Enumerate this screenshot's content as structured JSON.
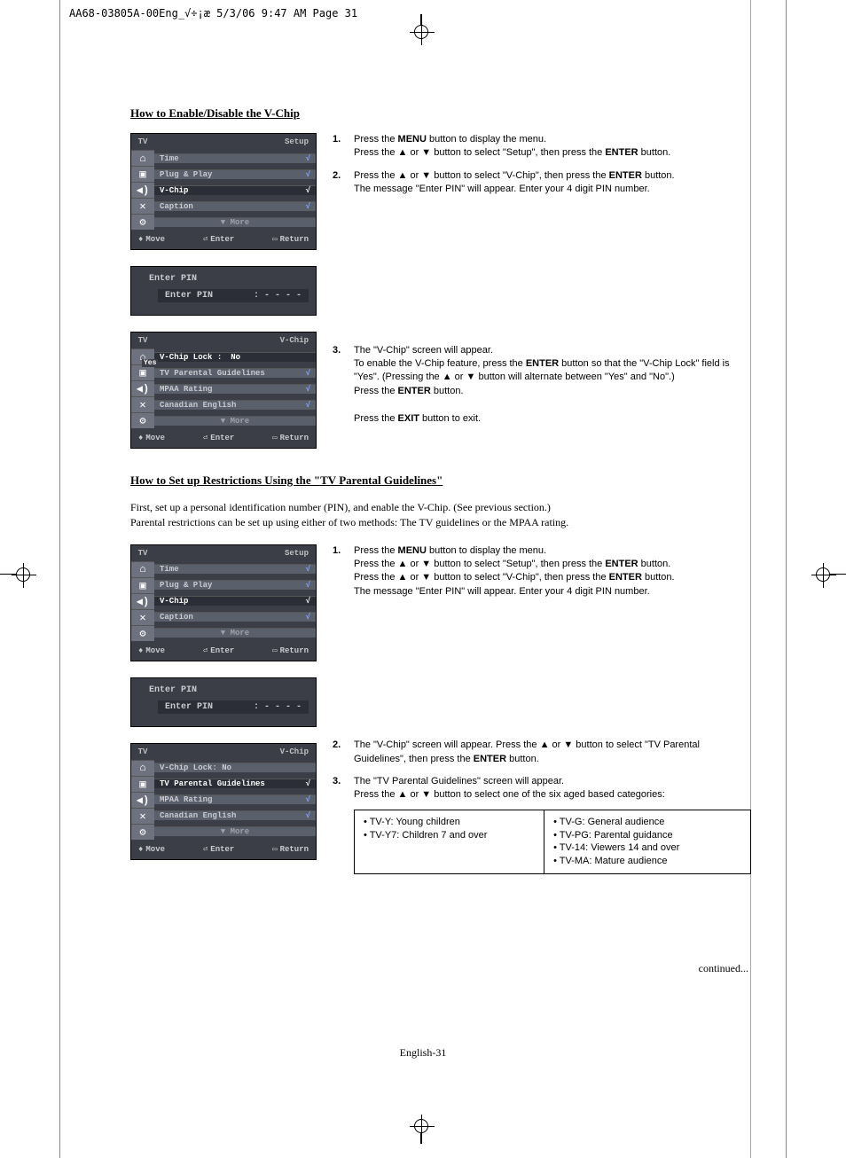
{
  "header_text": "AA68-03805A-00Eng_√÷¡æ  5/3/06  9:47 AM  Page 31",
  "section1": {
    "heading": "How to Enable/Disable the V-Chip",
    "menu_setup": {
      "sidebar_label": "TV",
      "title": "Setup",
      "items": [
        {
          "label": "Time",
          "arrow": "√"
        },
        {
          "label": "Plug & Play",
          "arrow": "√"
        },
        {
          "label": "V-Chip",
          "arrow": "√",
          "selected": true
        },
        {
          "label": "Caption",
          "arrow": "√"
        }
      ],
      "more": "▼ More",
      "footer": {
        "move": "Move",
        "enter": "Enter",
        "return": "Return"
      }
    },
    "pin_panel": {
      "title": "Enter PIN",
      "label": "Enter PIN",
      "value": ": - - - -"
    },
    "menu_vchip": {
      "sidebar_label": "TV",
      "title": "V-Chip",
      "lock_label": "V-Chip Lock",
      "lock_value": "No",
      "lock_alt": "Yes",
      "items": [
        {
          "label": "TV Parental Guidelines",
          "arrow": "√"
        },
        {
          "label": "MPAA Rating",
          "arrow": "√"
        },
        {
          "label": "Canadian English",
          "arrow": "√"
        }
      ],
      "more": "▼ More",
      "footer": {
        "move": "Move",
        "enter": "Enter",
        "return": "Return"
      }
    },
    "steps": {
      "s1": {
        "num": "1.",
        "parts": [
          "Press the ",
          "MENU",
          " button to display the menu.",
          "Press the ▲ or ▼ button to select \"Setup\", then press the ",
          "ENTER",
          " button."
        ]
      },
      "s2": {
        "num": "2.",
        "parts": [
          "Press the ▲ or ▼ button to select \"V-Chip\", then press the ",
          "ENTER",
          " button.",
          "The message \"Enter PIN\" will appear. Enter your 4 digit PIN number."
        ]
      },
      "s3": {
        "num": "3.",
        "parts": [
          "The \"V-Chip\" screen will appear.",
          "To enable the V-Chip feature, press the ",
          "ENTER",
          " button so that the \"V-Chip Lock\" field is \"Yes\". (Pressing the ▲ or ▼ button will alternate between \"Yes\" and \"No\".)",
          "Press the ",
          "ENTER",
          " button.",
          "Press the ",
          "EXIT",
          " button to exit."
        ]
      }
    }
  },
  "section2": {
    "heading": "How to Set up Restrictions Using the \"TV Parental Guidelines\"",
    "intro1": "First, set up a personal identification number (PIN), and enable the V-Chip. (See previous section.)",
    "intro2": "Parental restrictions can be set up using either of two methods: The TV guidelines or the MPAA rating.",
    "steps": {
      "s1": {
        "num": "1.",
        "parts": [
          "Press the ",
          "MENU",
          " button to display the menu.",
          "Press the ▲ or ▼ button to select \"Setup\", then press the ",
          "ENTER",
          " button.",
          "Press the ▲ or ▼ button to select \"V-Chip\", then press the ",
          "ENTER",
          " button.",
          "The message \"Enter PIN\" will appear. Enter your 4 digit PIN number."
        ]
      },
      "s2": {
        "num": "2.",
        "parts": [
          "The \"V-Chip\" screen will appear. Press the ▲ or ▼ button to select \"TV Parental Guidelines\", then press the ",
          "ENTER",
          " button."
        ]
      },
      "s3": {
        "num": "3.",
        "parts": [
          "The \"TV Parental Guidelines\" screen will appear.",
          "Press the ▲ or ▼ button to select one of the six aged based categories:"
        ]
      }
    },
    "menu_vchip2": {
      "lock_label": "V-Chip Lock",
      "lock_value": ": No",
      "items": [
        {
          "label": "TV Parental Guidelines",
          "arrow": "√",
          "selected": true
        },
        {
          "label": "MPAA Rating",
          "arrow": "√"
        },
        {
          "label": "Canadian English",
          "arrow": "√"
        }
      ]
    },
    "ratings": {
      "left": [
        "• TV-Y: Young children",
        "• TV-Y7: Children 7 and over"
      ],
      "right": [
        "• TV-G:   General audience",
        "• TV-PG: Parental guidance",
        "• TV-14:  Viewers 14 and over",
        "• TV-MA: Mature audience"
      ]
    }
  },
  "continued": "continued...",
  "footer": "English-31"
}
